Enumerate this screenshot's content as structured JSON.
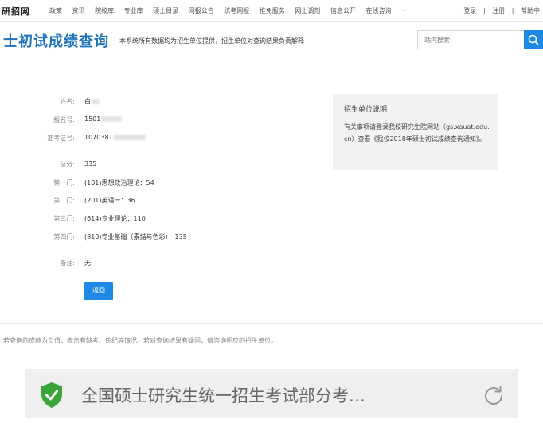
{
  "topbar": {
    "logo": "研招网",
    "nav": [
      "政策",
      "资讯",
      "院校库",
      "专业库",
      "硕士目录",
      "网报公告",
      "统考网报",
      "推免服务",
      "网上调剂",
      "信息公开",
      "在线咨询"
    ],
    "more": "···",
    "right": [
      "登录",
      "|",
      "注册",
      "|",
      "帮助中"
    ]
  },
  "header": {
    "title": "士初试成绩查询",
    "notice": "本系统所有数据均为招生单位提供，招生单位对查询结果负责解释",
    "search_placeholder": "站内搜索"
  },
  "result": {
    "fields": [
      {
        "label": "姓名:",
        "value": "白"
      },
      {
        "label": "报名号:",
        "value": "1501"
      },
      {
        "label": "准考证号:",
        "value": "1070381"
      },
      {
        "label": "总分:",
        "value": "335"
      },
      {
        "label": "第一门:",
        "value": "(101)思想政治理论：54"
      },
      {
        "label": "第二门:",
        "value": "(201)英语一：36"
      },
      {
        "label": "第三门:",
        "value": "(614)专业理论：110"
      },
      {
        "label": "第四门:",
        "value": "(810)专业基础（素描与色彩）：135"
      },
      {
        "label": "备注:",
        "value": "无"
      }
    ],
    "back_button": "返回"
  },
  "info": {
    "heading": "招生单位说明",
    "body": "有关事项请登录我校研究生院网站（gs.xauat.edu.cn）查看《我校2018年硕士初试成绩查询通知》。"
  },
  "footnote": "若查询的成绩为负值，表示有缺考、违纪等情况。若对查询结果有疑问，请咨询相应的招生单位。",
  "browser": {
    "page_title": "全国硕士研究生统一招生考试部分考…",
    "accent": "#3aa63a"
  },
  "colors": {
    "primary": "#1e88e5",
    "title": "#1e73be"
  }
}
